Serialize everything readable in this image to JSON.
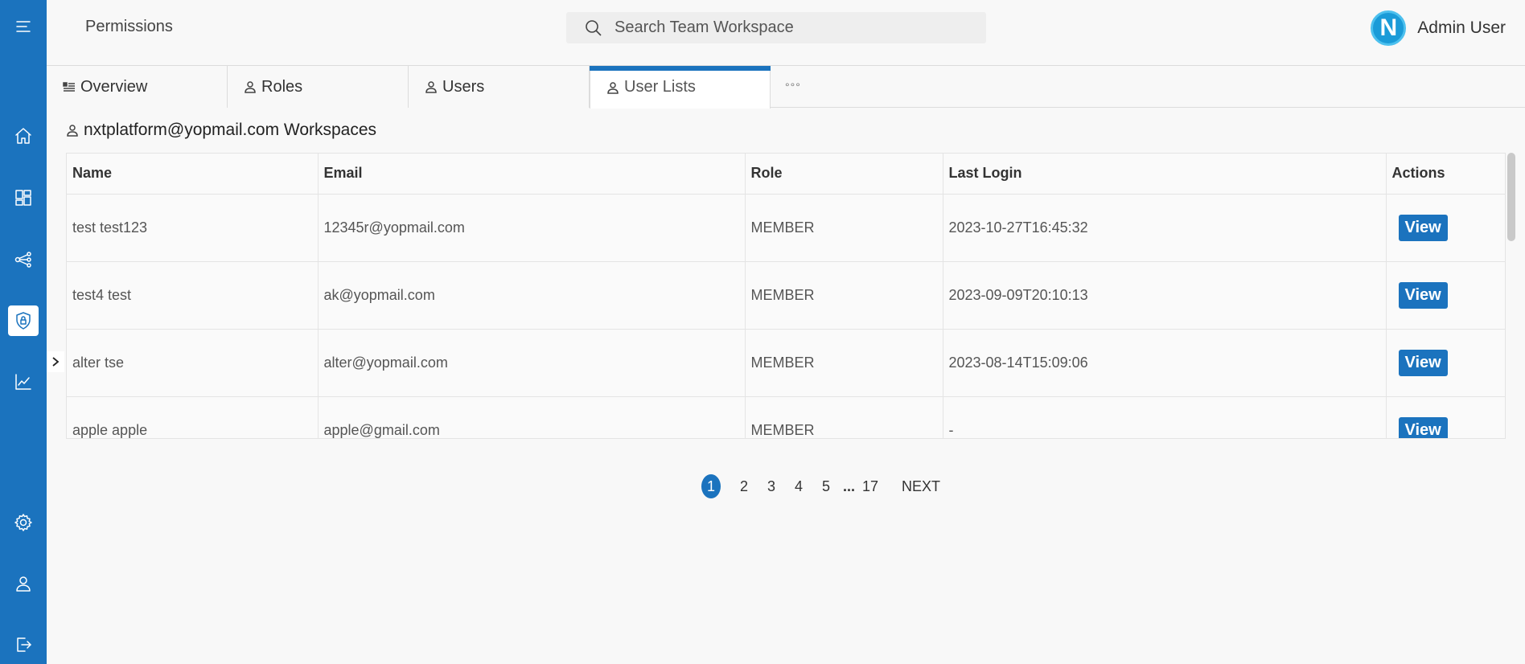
{
  "header": {
    "title": "Permissions",
    "search_placeholder": "Search Team Workspace",
    "avatar_letter": "N",
    "user_name": "Admin User"
  },
  "sidebar": {
    "items": [
      {
        "name": "menu-icon"
      },
      {
        "name": "home-icon"
      },
      {
        "name": "dashboard-icon"
      },
      {
        "name": "share-nodes-icon"
      },
      {
        "name": "shield-lock-icon",
        "active": true
      },
      {
        "name": "analytics-icon"
      },
      {
        "name": "gear-icon"
      },
      {
        "name": "user-icon"
      },
      {
        "name": "logout-icon"
      }
    ]
  },
  "tabs": [
    {
      "label": "Overview",
      "icon": "list-icon"
    },
    {
      "label": "Roles",
      "icon": "user-icon"
    },
    {
      "label": "Users",
      "icon": "user-icon"
    },
    {
      "label": "User Lists",
      "icon": "user-icon",
      "active": true
    }
  ],
  "tab_more": "°°°",
  "section": {
    "title": "nxtplatform@yopmail.com Workspaces"
  },
  "table": {
    "columns": [
      "Name",
      "Email",
      "Role",
      "Last Login",
      "Actions"
    ],
    "rows": [
      {
        "name": "test test123",
        "email": "12345r@yopmail.com",
        "role": "MEMBER",
        "last_login": "2023-10-27T16:45:32",
        "action": "View"
      },
      {
        "name": "test4 test",
        "email": "ak@yopmail.com",
        "role": "MEMBER",
        "last_login": "2023-09-09T20:10:13",
        "action": "View"
      },
      {
        "name": "alter tse",
        "email": "alter@yopmail.com",
        "role": "MEMBER",
        "last_login": "2023-08-14T15:09:06",
        "action": "View"
      },
      {
        "name": "apple apple",
        "email": "apple@gmail.com",
        "role": "MEMBER",
        "last_login": "-",
        "action": "View"
      }
    ]
  },
  "pagination": {
    "pages": [
      "1",
      "2",
      "3",
      "4",
      "5"
    ],
    "ellipsis": "...",
    "last": "17",
    "next": "NEXT",
    "current": "1"
  },
  "colors": {
    "accent": "#1b73be",
    "background": "#f8f8f8"
  }
}
